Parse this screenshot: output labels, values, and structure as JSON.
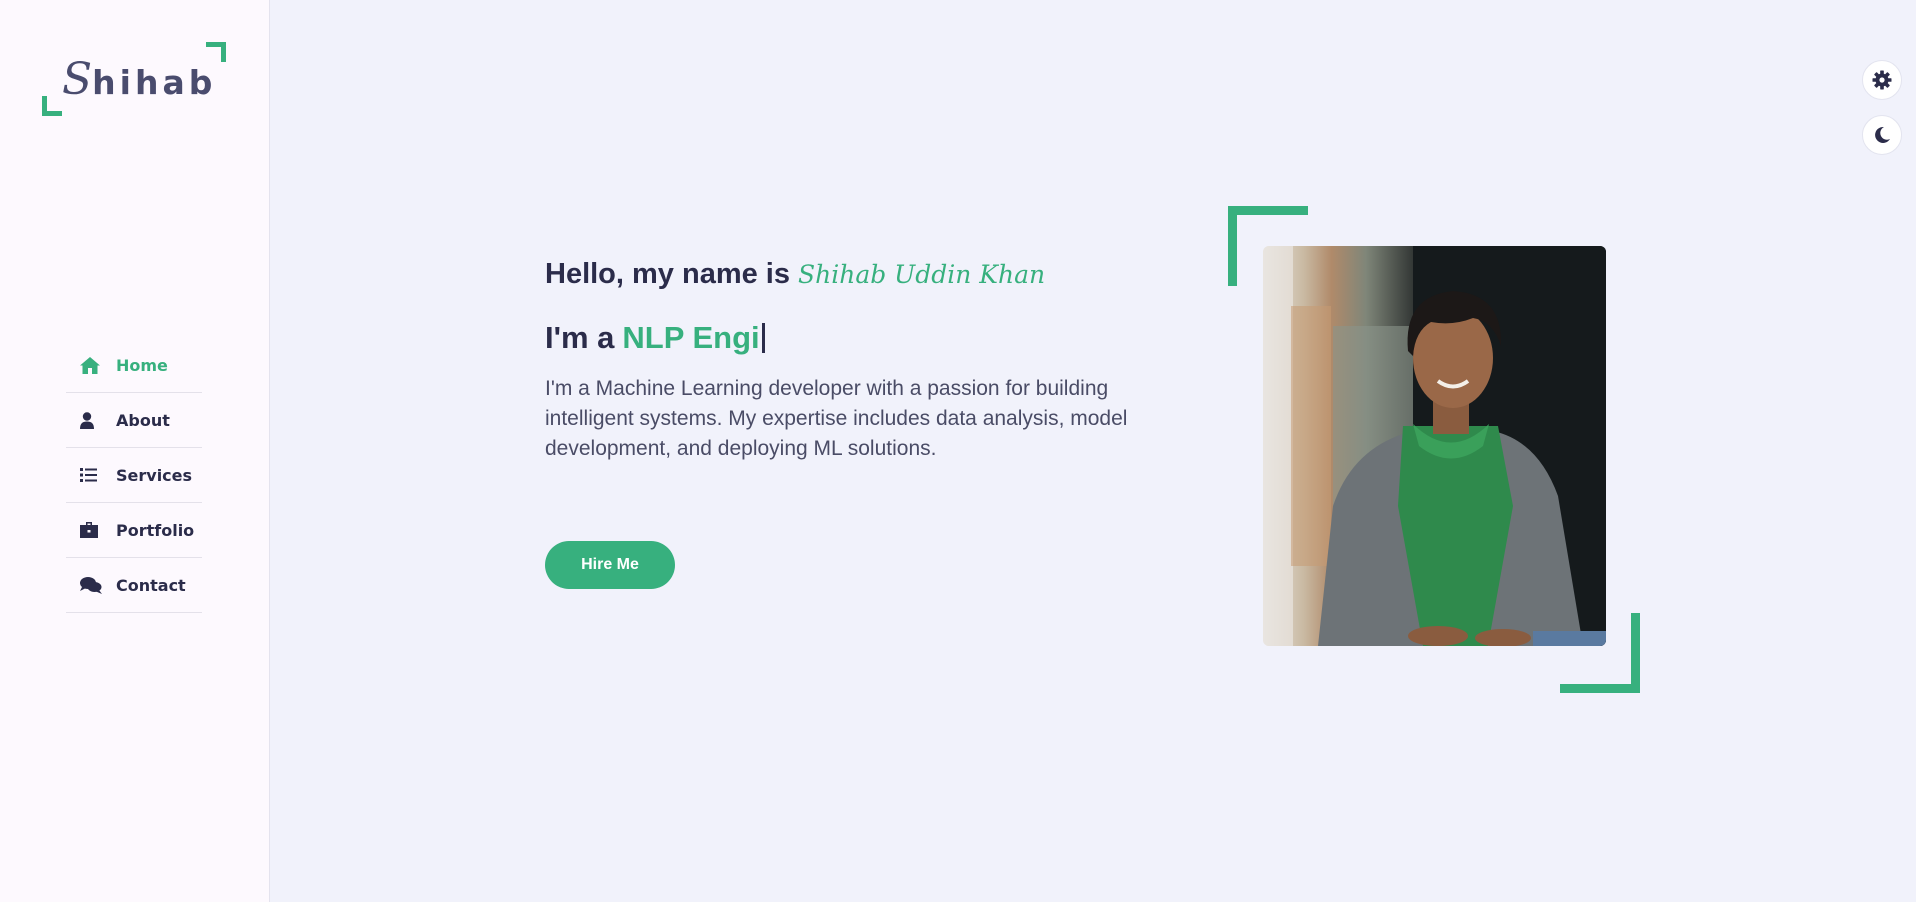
{
  "logo": {
    "first_letter": "S",
    "rest": "hihab"
  },
  "nav": {
    "items": [
      {
        "label": "Home",
        "icon": "home-icon",
        "active": true
      },
      {
        "label": "About",
        "icon": "user-icon",
        "active": false
      },
      {
        "label": "Services",
        "icon": "list-icon",
        "active": false
      },
      {
        "label": "Portfolio",
        "icon": "briefcase-icon",
        "active": false
      },
      {
        "label": "Contact",
        "icon": "comments-icon",
        "active": false
      }
    ]
  },
  "tools": {
    "settings_icon": "gear-icon",
    "theme_icon": "moon-icon"
  },
  "hero": {
    "greeting": "Hello, my name is",
    "name": "Shihab Uddin Khan",
    "role_prefix": "I'm a",
    "role_typed": "NLP Engi",
    "description": "I'm a Machine Learning developer with a passion for building intelligent systems. My expertise includes data analysis, model development, and deploying ML solutions.",
    "cta_label": "Hire Me"
  },
  "colors": {
    "accent": "#37b07e",
    "text": "#2b2c4a",
    "background": "#f1f2fb",
    "sidebar": "#fdf9fe"
  }
}
